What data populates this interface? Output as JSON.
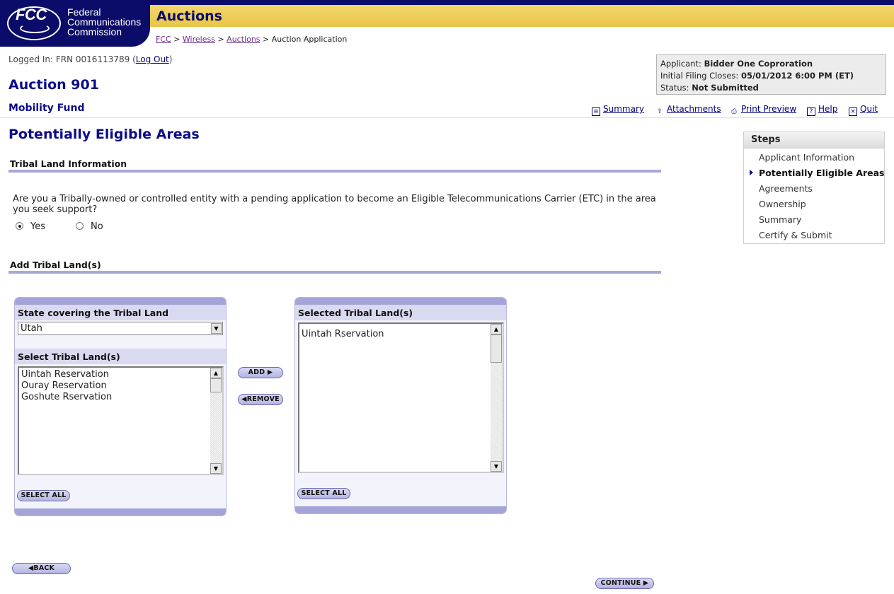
{
  "header": {
    "logo_text": "FCC",
    "agency_lines": [
      "Federal",
      "Communications",
      "Commission"
    ],
    "section_title": "Auctions",
    "breadcrumb": {
      "items": [
        "FCC",
        "Wireless",
        "Auctions"
      ],
      "separator": ">",
      "current": "Auction Application"
    }
  },
  "session": {
    "logged_in_prefix": "Logged In: FRN 0016113789",
    "logout_label": "Log Out"
  },
  "auction": {
    "title": "Auction 901",
    "subtitle": "Mobility Fund"
  },
  "applicant_box": {
    "applicant_label": "Applicant:",
    "applicant_value": "Bidder One Coproration",
    "closes_label": "Initial Filing Closes:",
    "closes_value": "05/01/2012 6:00 PM (ET)",
    "status_label": "Status:",
    "status_value": "Not Submitted"
  },
  "top_links": [
    {
      "label": "Summary",
      "icon": "summary-icon"
    },
    {
      "label": "Attachments",
      "icon": "attachments-icon"
    },
    {
      "label": "Print Preview",
      "icon": "printer-icon"
    },
    {
      "label": "Help",
      "icon": "help-icon"
    },
    {
      "label": "Quit",
      "icon": "quit-icon"
    }
  ],
  "page_title": "Potentially Eligible Areas",
  "tribal_info": {
    "section_title": "Tribal Land Information",
    "question": "Are you a Tribally-owned or controlled entity with a pending application to become an Eligible Telecommunications Carrier (ETC) in the area you seek support?",
    "yes_label": "Yes",
    "no_label": "No",
    "selected": "Yes"
  },
  "add_tribal": {
    "section_title": "Add Tribal Land(s)",
    "state_panel_title": "State covering the Tribal Land",
    "state_value": "Utah",
    "select_title": "Select Tribal Land(s)",
    "available": [
      "Uintah Reservation",
      "Ouray Reservation",
      "Goshute Rservation"
    ],
    "select_all_label": "SELECT ALL",
    "add_label": "ADD",
    "remove_label": "REMOVE",
    "selected_panel_title": "Selected Tribal Land(s)",
    "selected": [
      "Uintah Rservation"
    ],
    "selected_select_all_label": "SELECT ALL"
  },
  "nav": {
    "back_label": "BACK",
    "continue_label": "CONTINUE"
  },
  "steps": {
    "title": "Steps",
    "items": [
      "Applicant Information",
      "Potentially Eligible Areas",
      "Agreements",
      "Ownership",
      "Summary",
      "Certify & Submit"
    ],
    "active_index": 1
  },
  "colors": {
    "header_navy": "#0b0b6a",
    "header_yellow": "#e8c545",
    "link": "#000080",
    "section_rule": "#a8a8d8",
    "panel_bg": "#f3f3fb"
  }
}
